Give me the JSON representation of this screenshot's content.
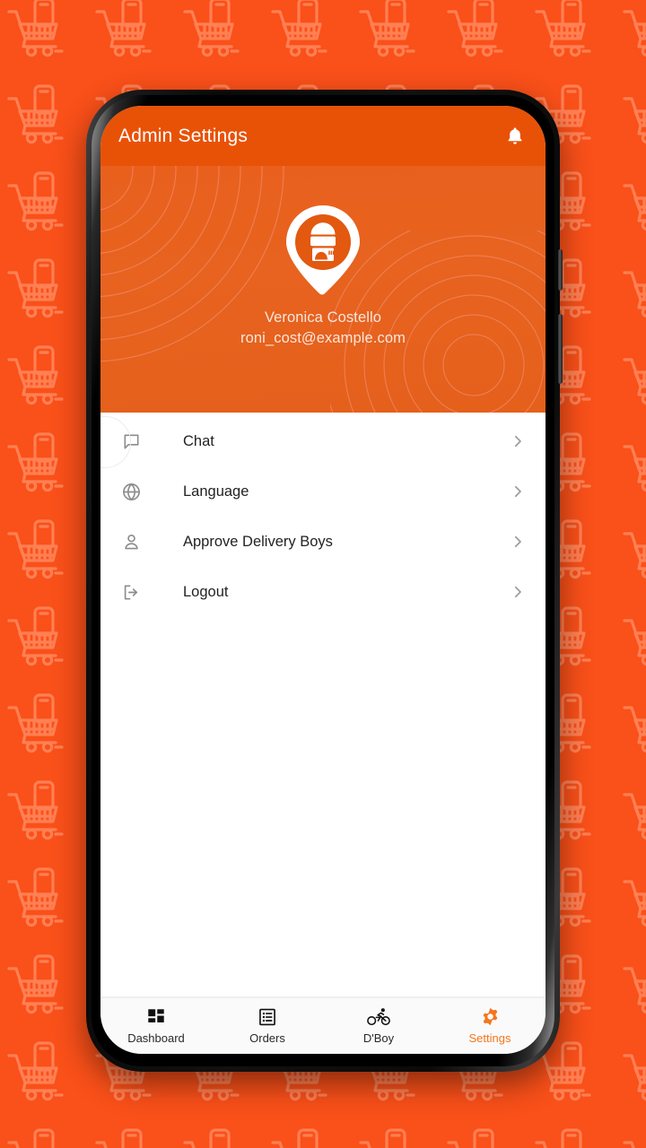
{
  "wallpaper": {
    "icon": "shopping-cart-with-phone-pattern",
    "bg_color": "#FA5019",
    "pattern_color": "#FF8054"
  },
  "appbar": {
    "title": "Admin Settings",
    "bg_color": "#E85207",
    "notification_icon": "bell-icon"
  },
  "profile": {
    "avatar_icon": "delivery-person-map-pin-avatar",
    "name": "Veronica Costello",
    "email": "roni_cost@example.com",
    "bg_color": "#E9601D"
  },
  "menu": {
    "items": [
      {
        "label": "Chat",
        "icon": "chat-bubble-icon",
        "chevron": "chevron-right-icon"
      },
      {
        "label": "Language",
        "icon": "globe-icon",
        "chevron": "chevron-right-icon"
      },
      {
        "label": "Approve Delivery Boys",
        "icon": "person-icon",
        "chevron": "chevron-right-icon"
      },
      {
        "label": "Logout",
        "icon": "logout-icon",
        "chevron": "chevron-right-icon"
      }
    ]
  },
  "bottom_nav": {
    "active_color": "#F4761C",
    "items": [
      {
        "label": "Dashboard",
        "icon": "grid-dashboard-icon",
        "active": false
      },
      {
        "label": "Orders",
        "icon": "list-orders-icon",
        "active": false
      },
      {
        "label": "D'Boy",
        "icon": "bicycle-icon",
        "active": false
      },
      {
        "label": "Settings",
        "icon": "gear-icon",
        "active": true
      }
    ]
  }
}
